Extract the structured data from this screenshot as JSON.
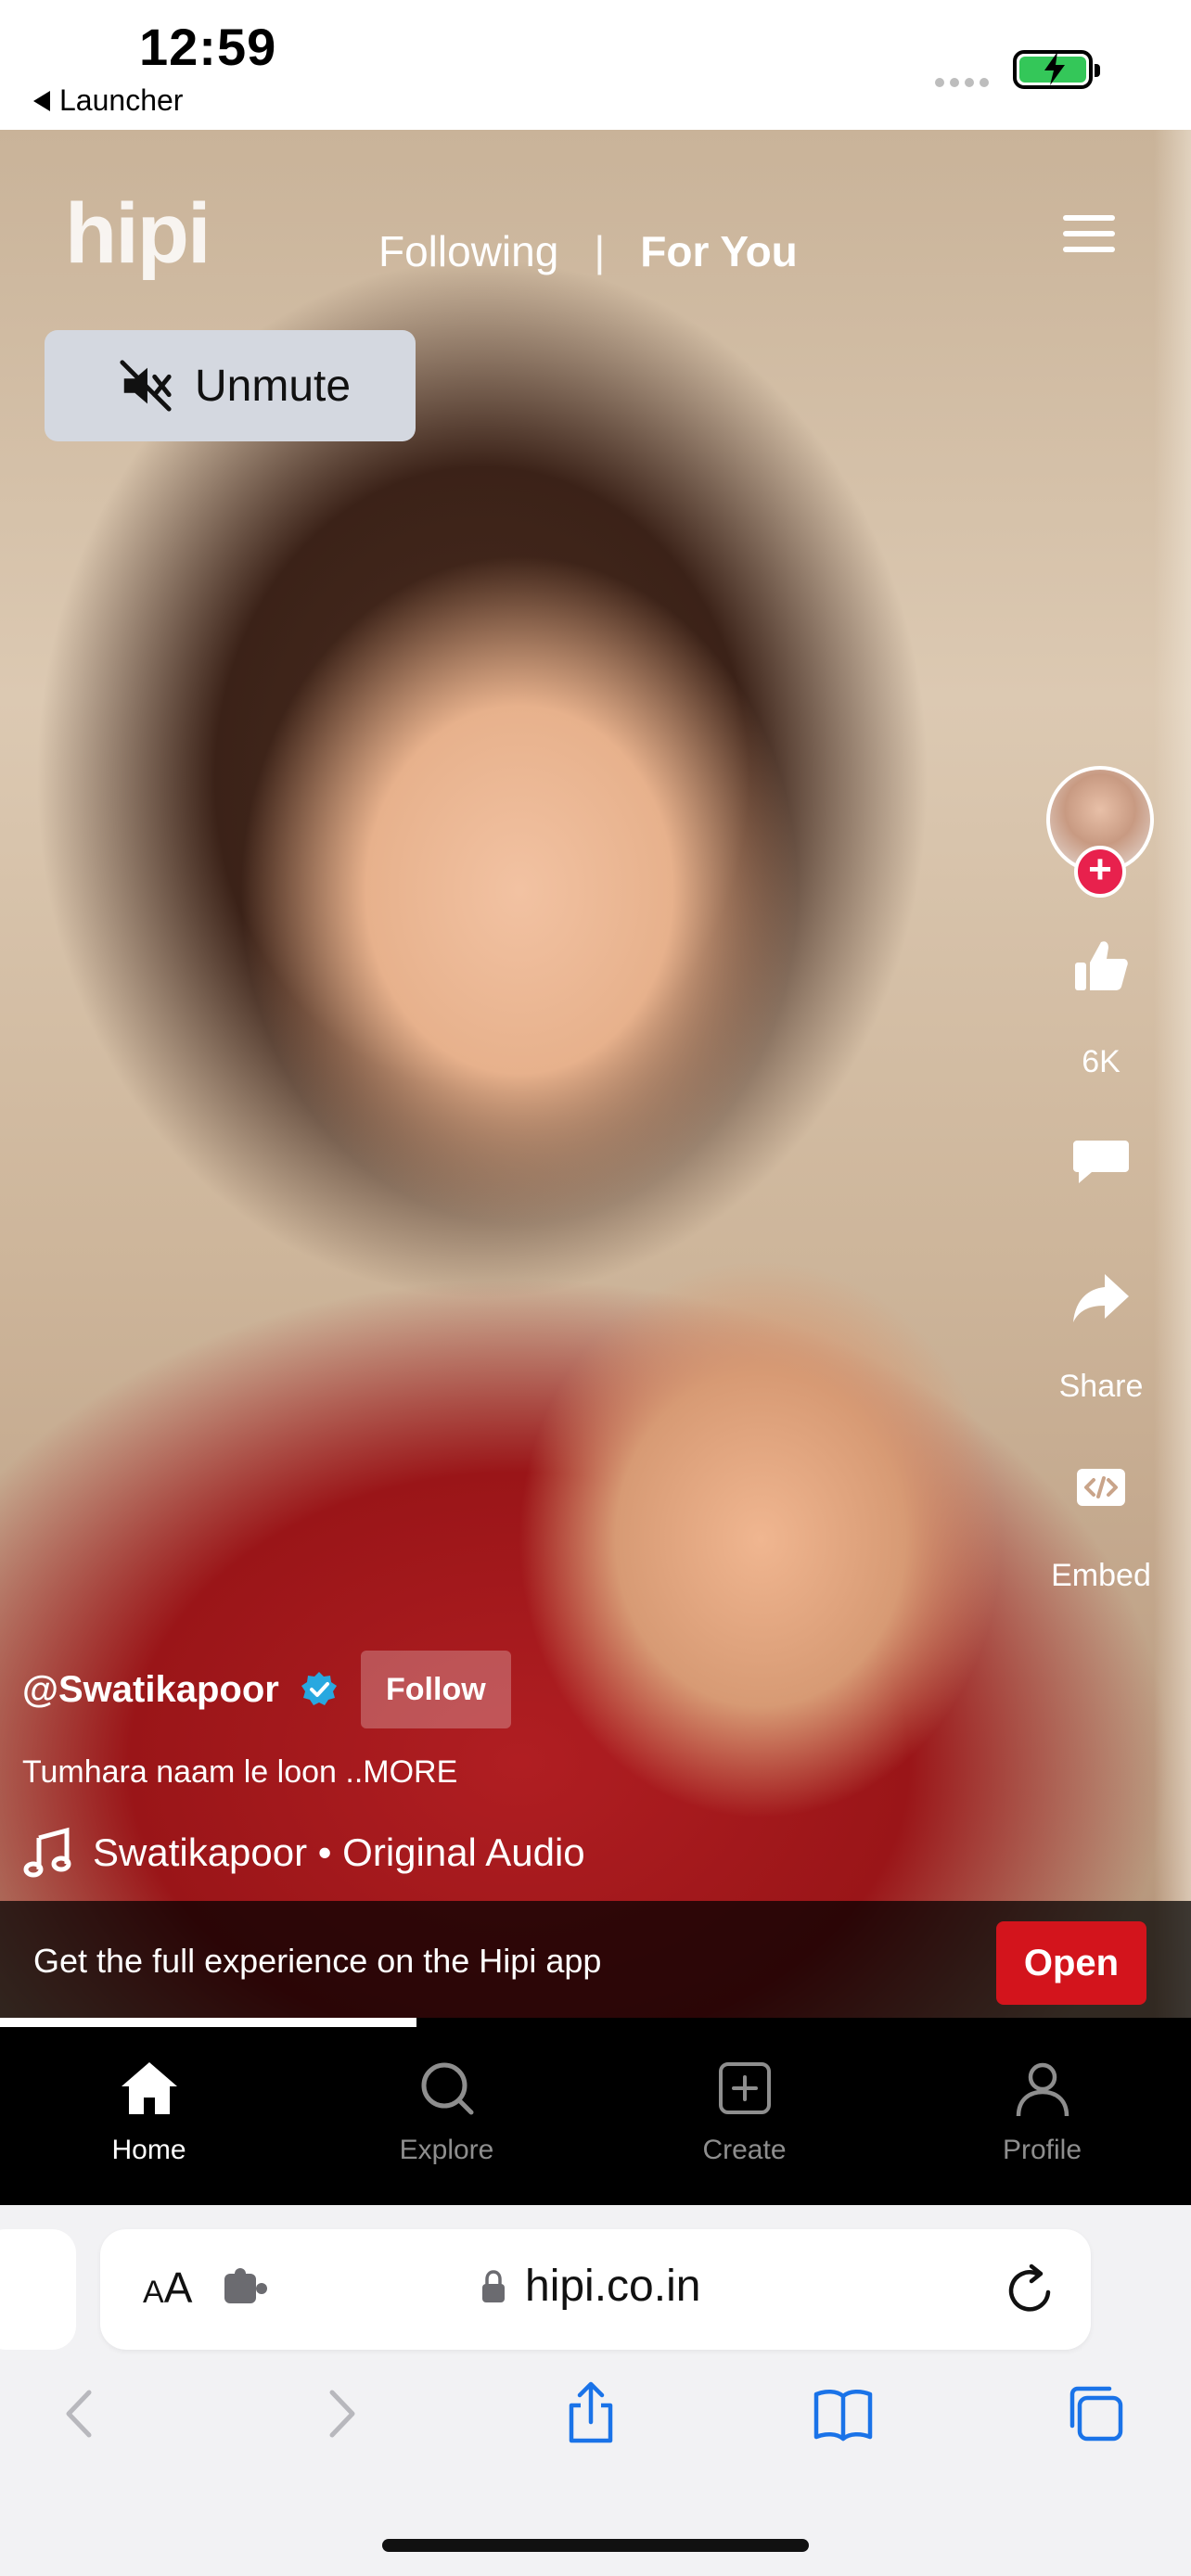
{
  "status_bar": {
    "time": "12:59",
    "back_label": "Launcher"
  },
  "app": {
    "logo": "hipi",
    "feed_tabs": [
      {
        "label": "Following",
        "active": false
      },
      {
        "label": "For You",
        "active": true
      }
    ],
    "unmute_label": "Unmute",
    "side_actions": {
      "like_count": "6K",
      "share_label": "Share",
      "embed_label": "Embed"
    },
    "post": {
      "username": "@Swatikapoor",
      "verified": true,
      "follow_label": "Follow",
      "caption": "Tumhara naam le loon ..MORE",
      "audio": "Swatikapoor • Original Audio"
    },
    "banner": {
      "message": "Get the full experience on the Hipi app",
      "open_label": "Open",
      "open_color": "#d3141c"
    },
    "progress": 0.35,
    "bottom_nav": [
      {
        "label": "Home",
        "icon": "home-icon",
        "active": true
      },
      {
        "label": "Explore",
        "icon": "search-icon",
        "active": false
      },
      {
        "label": "Create",
        "icon": "plus-square-icon",
        "active": false
      },
      {
        "label": "Profile",
        "icon": "profile-icon",
        "active": false
      }
    ]
  },
  "browser": {
    "text_size_label": "AA",
    "url": "hipi.co.in",
    "accent": "#1a73e8"
  }
}
